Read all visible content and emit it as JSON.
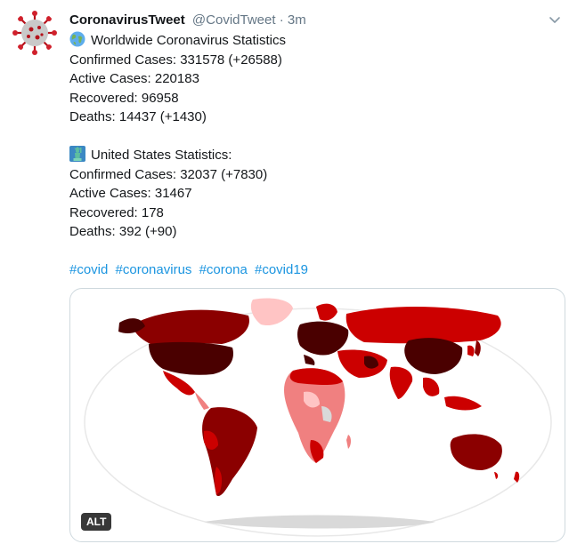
{
  "tweet": {
    "author_name": "CoronavirusTweet",
    "handle": "@CovidTweet",
    "separator": "·",
    "time": "3m",
    "worldwide": {
      "heading": "Worldwide Coronavirus Statistics",
      "emoji": "globe-icon",
      "confirmed": "Confirmed Cases: 331578 (+26588)",
      "active": "Active Cases: 220183",
      "recovered": "Recovered: 96958",
      "deaths": "Deaths: 14437 (+1430)"
    },
    "us": {
      "heading": "United States Statistics:",
      "emoji": "statue-of-liberty-icon",
      "confirmed": "Confirmed Cases: 32037 (+7830)",
      "active": "Active Cases: 31467",
      "recovered": "Recovered: 178",
      "deaths": "Deaths: 392 (+90)"
    },
    "hashtags": [
      "#covid",
      "#coronavirus",
      "#corona",
      "#covid19"
    ],
    "media": {
      "alt_label": "ALT",
      "colors": {
        "darkest": "#4a0000",
        "dark": "#8b0000",
        "mid": "#cc0000",
        "light": "#f08080",
        "lightest": "#ffc4c4",
        "no_data": "#d9d9d9"
      }
    },
    "link_color": "#1b95e0"
  }
}
